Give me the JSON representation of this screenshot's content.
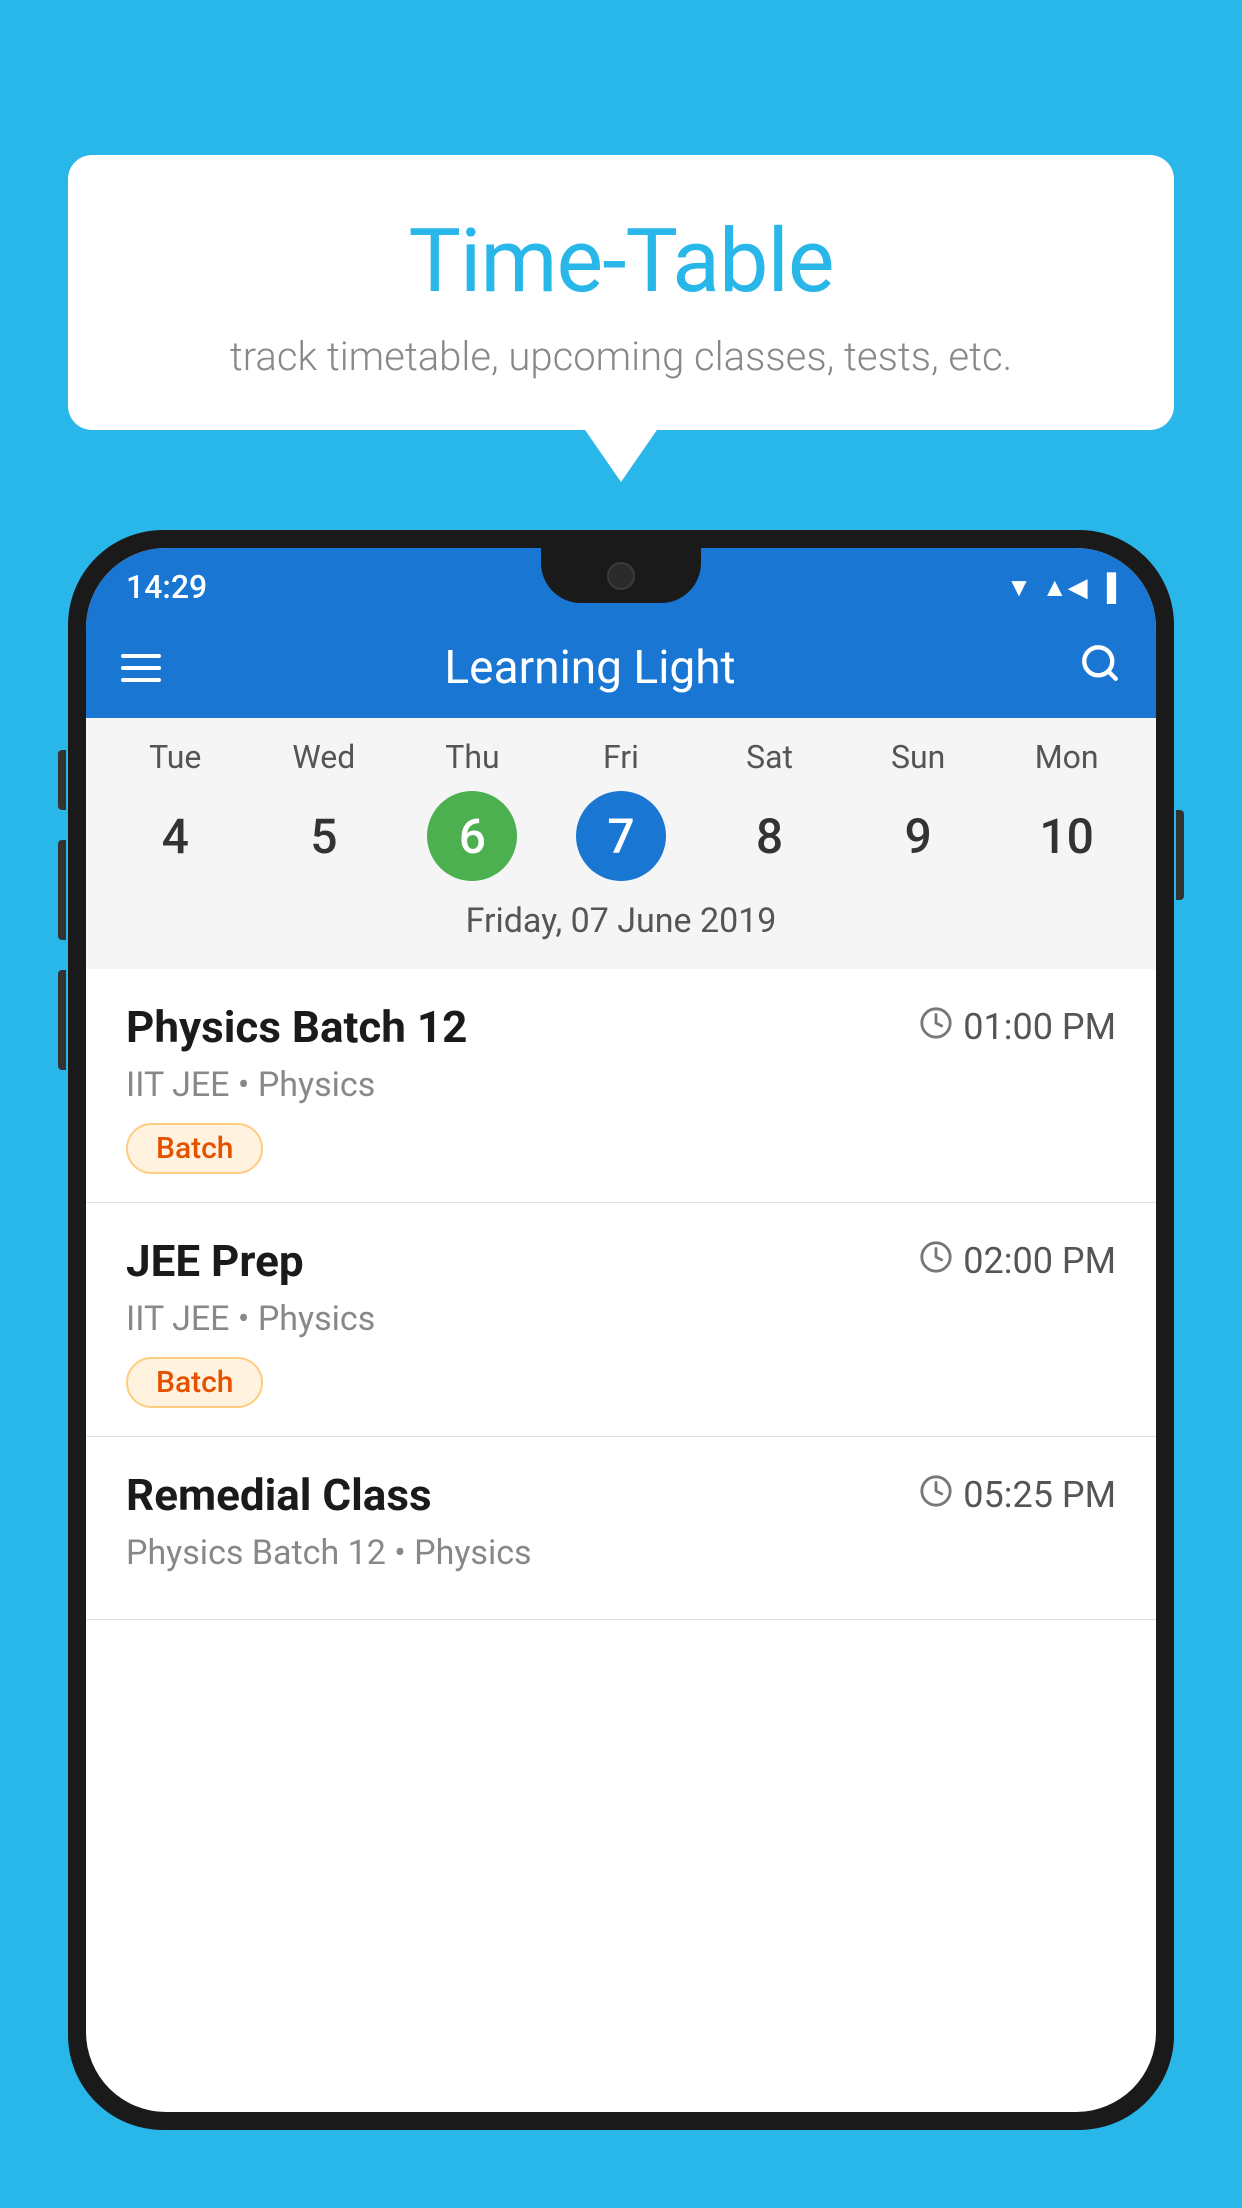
{
  "page": {
    "background_color": "#29B6E8"
  },
  "speech_bubble": {
    "title": "Time-Table",
    "subtitle": "track timetable, upcoming classes, tests, etc."
  },
  "app": {
    "title": "Learning Light",
    "status_bar": {
      "time": "14:29"
    }
  },
  "calendar": {
    "selected_date_label": "Friday, 07 June 2019",
    "days": [
      {
        "label": "Tue",
        "number": "4",
        "state": "normal"
      },
      {
        "label": "Wed",
        "number": "5",
        "state": "normal"
      },
      {
        "label": "Thu",
        "number": "6",
        "state": "today"
      },
      {
        "label": "Fri",
        "number": "7",
        "state": "selected"
      },
      {
        "label": "Sat",
        "number": "8",
        "state": "normal"
      },
      {
        "label": "Sun",
        "number": "9",
        "state": "normal"
      },
      {
        "label": "Mon",
        "number": "10",
        "state": "normal"
      }
    ]
  },
  "schedule_items": [
    {
      "name": "Physics Batch 12",
      "time": "01:00 PM",
      "meta": "IIT JEE • Physics",
      "badge": "Batch"
    },
    {
      "name": "JEE Prep",
      "time": "02:00 PM",
      "meta": "IIT JEE • Physics",
      "badge": "Batch"
    },
    {
      "name": "Remedial Class",
      "time": "05:25 PM",
      "meta": "Physics Batch 12 • Physics",
      "badge": null
    }
  ],
  "labels": {
    "hamburger": "☰",
    "search": "🔍",
    "clock": "🕐",
    "batch": "Batch"
  }
}
